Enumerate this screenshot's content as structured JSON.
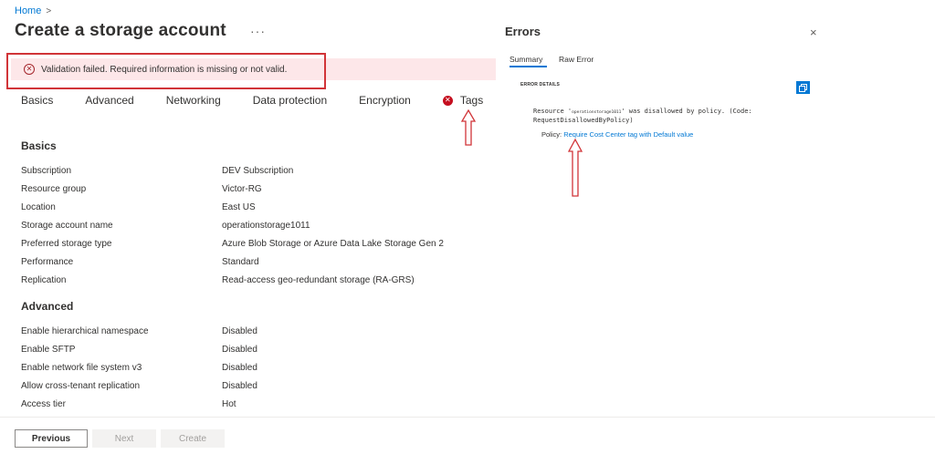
{
  "breadcrumb": {
    "home": "Home",
    "separator": ">"
  },
  "page": {
    "title": "Create a storage account",
    "more": "···"
  },
  "validation": {
    "message": "Validation failed. Required information is missing or not valid."
  },
  "tabs": [
    "Basics",
    "Advanced",
    "Networking",
    "Data protection",
    "Encryption",
    "Tags"
  ],
  "basics": {
    "heading": "Basics",
    "rows": [
      {
        "label": "Subscription",
        "value": "DEV Subscription"
      },
      {
        "label": "Resource group",
        "value": "Victor-RG"
      },
      {
        "label": "Location",
        "value": "East US"
      },
      {
        "label": "Storage account name",
        "value": "operationstorage1011"
      },
      {
        "label": "Preferred storage type",
        "value": "Azure Blob Storage or Azure Data Lake Storage Gen 2"
      },
      {
        "label": "Performance",
        "value": "Standard"
      },
      {
        "label": "Replication",
        "value": "Read-access geo-redundant storage (RA-GRS)"
      }
    ]
  },
  "advanced": {
    "heading": "Advanced",
    "rows": [
      {
        "label": "Enable hierarchical namespace",
        "value": "Disabled"
      },
      {
        "label": "Enable SFTP",
        "value": "Disabled"
      },
      {
        "label": "Enable network file system v3",
        "value": "Disabled"
      },
      {
        "label": "Allow cross-tenant replication",
        "value": "Disabled"
      },
      {
        "label": "Access tier",
        "value": "Hot"
      }
    ]
  },
  "footer": {
    "previous": "Previous",
    "next": "Next",
    "create": "Create"
  },
  "errors_panel": {
    "title": "Errors",
    "close": "×",
    "tabs": {
      "summary": "Summary",
      "raw": "Raw Error"
    },
    "details_label": "ERROR DETAILS",
    "message_prefix": "Resource '",
    "resource_name": "operationstorage1011",
    "message_suffix": "' was disallowed by policy. (Code:",
    "message_code": "RequestDisallowedByPolicy)",
    "policy_label": "Policy: ",
    "policy_link": "Require Cost Center tag with Default value"
  },
  "colors": {
    "accent": "#0078d4",
    "error": "#c50f1f",
    "highlight": "#d13438",
    "error_bg": "#fde7e9"
  }
}
